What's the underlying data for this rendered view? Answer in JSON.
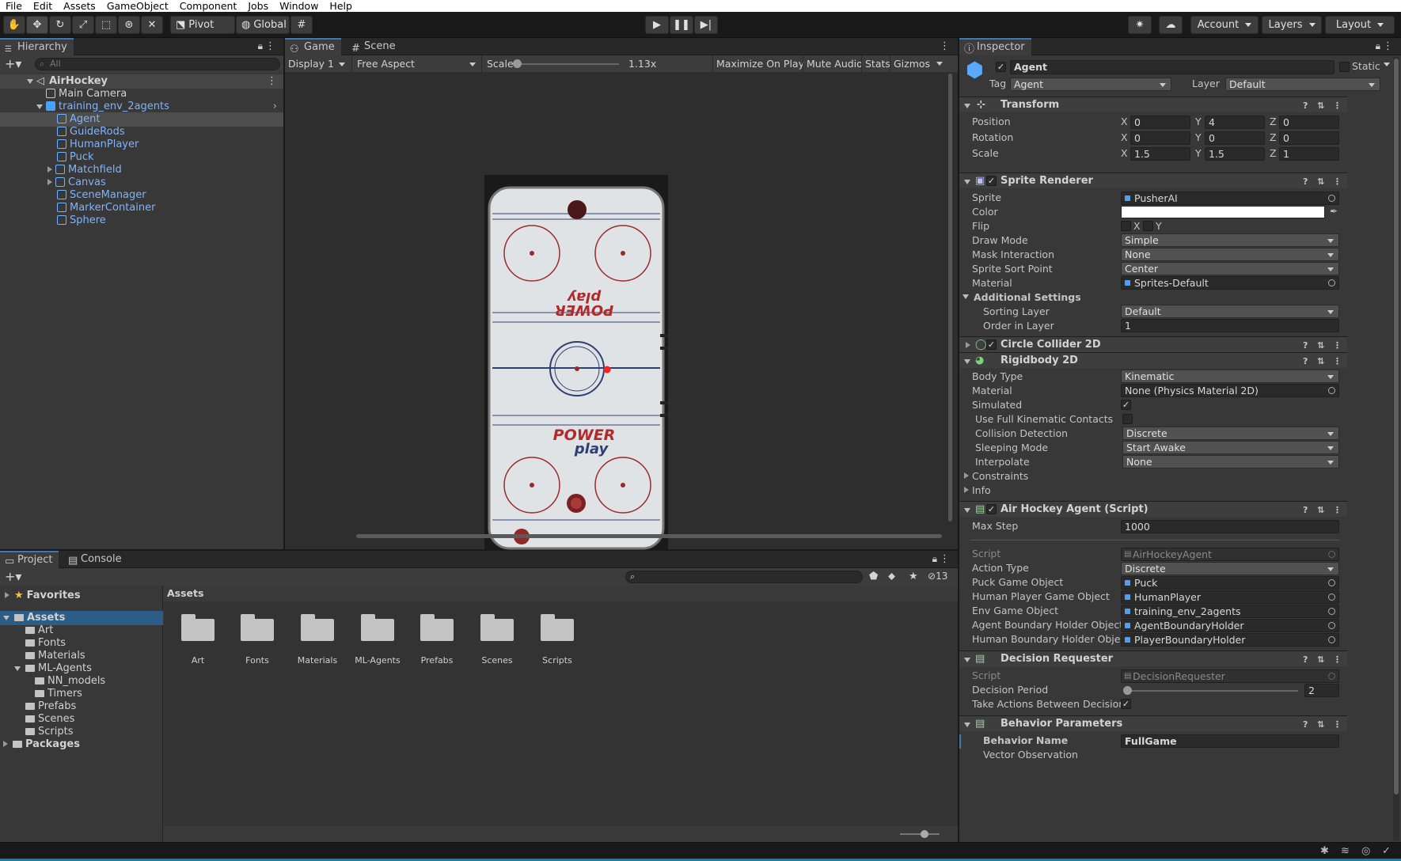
{
  "menu": [
    "File",
    "Edit",
    "Assets",
    "GameObject",
    "Component",
    "Jobs",
    "Window",
    "Help"
  ],
  "toolbar": {
    "pivot": "Pivot",
    "global": "Global",
    "account": "Account",
    "layers": "Layers",
    "layout": "Layout"
  },
  "hierarchy": {
    "tab": "Hierarchy",
    "search_placeholder": "All",
    "scene": "AirHockey",
    "items": [
      {
        "label": "Main Camera"
      },
      {
        "label": "training_env_2agents"
      },
      {
        "label": "Agent"
      },
      {
        "label": "GuideRods"
      },
      {
        "label": "HumanPlayer"
      },
      {
        "label": "Puck"
      },
      {
        "label": "Matchfield"
      },
      {
        "label": "Canvas"
      },
      {
        "label": "SceneManager"
      },
      {
        "label": "MarkerContainer"
      },
      {
        "label": "Sphere"
      }
    ]
  },
  "game": {
    "tab_game": "Game",
    "tab_scene": "Scene",
    "display": "Display 1",
    "aspect": "Free Aspect",
    "scale_label": "Scale",
    "scale_value": "1.13x",
    "scale_fraction": 0.02,
    "maximize": "Maximize On Play",
    "mute": "Mute Audio",
    "stats": "Stats",
    "gizmos": "Gizmos",
    "logo_top": "POWER play",
    "logo_bottom_1": "POWER",
    "logo_bottom_2": "play"
  },
  "project": {
    "tab_project": "Project",
    "tab_console": "Console",
    "hidden_count": "13",
    "favorites": "Favorites",
    "assets": "Assets",
    "tree": [
      "Art",
      "Fonts",
      "Materials",
      "ML-Agents",
      "NN_models",
      "Timers",
      "Prefabs",
      "Scenes",
      "Scripts"
    ],
    "packages": "Packages",
    "breadcrumb": "Assets",
    "folders": [
      "Art",
      "Fonts",
      "Materials",
      "ML-Agents",
      "Prefabs",
      "Scenes",
      "Scripts"
    ]
  },
  "inspector": {
    "tab": "Inspector",
    "name": "Agent",
    "static": "Static",
    "tag_label": "Tag",
    "tag": "Agent",
    "layer_label": "Layer",
    "layer": "Default",
    "transform": {
      "title": "Transform",
      "position_label": "Position",
      "position": [
        "0",
        "4",
        "0"
      ],
      "rotation_label": "Rotation",
      "rotation": [
        "0",
        "0",
        "0"
      ],
      "scale_label": "Scale",
      "scale": [
        "1.5",
        "1.5",
        "1"
      ]
    },
    "sprite_renderer": {
      "title": "Sprite Renderer",
      "sprite_label": "Sprite",
      "sprite": "PusherAI",
      "color_label": "Color",
      "color": "#ffffff",
      "flip_label": "Flip",
      "flip_x": "X",
      "flip_y": "Y",
      "draw_mode_label": "Draw Mode",
      "draw_mode": "Simple",
      "mask_label": "Mask Interaction",
      "mask": "None",
      "sort_point_label": "Sprite Sort Point",
      "sort_point": "Center",
      "material_label": "Material",
      "material": "Sprites-Default",
      "additional": "Additional Settings",
      "sorting_layer_label": "Sorting Layer",
      "sorting_layer": "Default",
      "order_label": "Order in Layer",
      "order": "1"
    },
    "circle_collider": {
      "title": "Circle Collider 2D"
    },
    "rigidbody": {
      "title": "Rigidbody 2D",
      "body_type_label": "Body Type",
      "body_type": "Kinematic",
      "material_label": "Material",
      "material": "None (Physics Material 2D)",
      "simulated_label": "Simulated",
      "full_kinematic_label": "Use Full Kinematic Contacts",
      "collision_label": "Collision Detection",
      "collision": "Discrete",
      "sleeping_label": "Sleeping Mode",
      "sleeping": "Start Awake",
      "interpolate_label": "Interpolate",
      "interpolate": "None",
      "constraints": "Constraints",
      "info": "Info"
    },
    "air_hockey_agent": {
      "title": "Air Hockey Agent (Script)",
      "max_step_label": "Max Step",
      "max_step": "1000",
      "script_label": "Script",
      "script": "AirHockeyAgent",
      "action_type_label": "Action Type",
      "action_type": "Discrete",
      "puck_label": "Puck Game Object",
      "puck": "Puck",
      "human_label": "Human Player Game Object",
      "human": "HumanPlayer",
      "env_label": "Env Game Object",
      "env": "training_env_2agents",
      "agent_boundary_label": "Agent Boundary Holder Object",
      "agent_boundary": "AgentBoundaryHolder",
      "human_boundary_label": "Human Boundary Holder Object",
      "human_boundary": "PlayerBoundaryHolder"
    },
    "decision_requester": {
      "title": "Decision Requester",
      "script_label": "Script",
      "script": "DecisionRequester",
      "period_label": "Decision Period",
      "period": "2",
      "period_fraction": 0.0,
      "take_actions_label": "Take Actions Between Decisions"
    },
    "behavior": {
      "title": "Behavior Parameters",
      "name_label": "Behavior Name",
      "name": "FullGame",
      "vector_obs_label": "Vector Observation"
    }
  }
}
